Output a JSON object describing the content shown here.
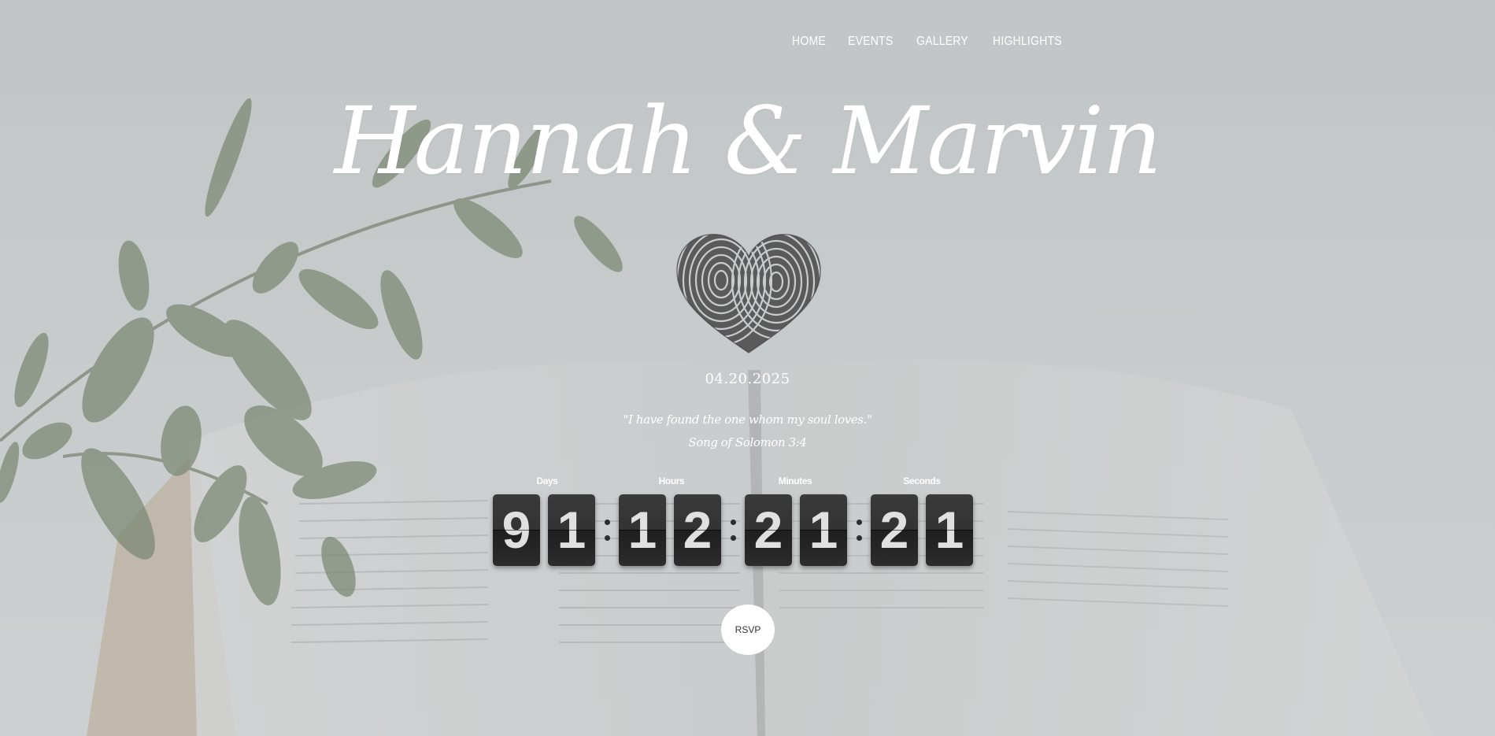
{
  "nav": {
    "items": [
      {
        "label": "HOME"
      },
      {
        "label": "EVENTS"
      },
      {
        "label": "GALLERY"
      },
      {
        "label": "HIGHLIGHTS"
      }
    ]
  },
  "hero": {
    "names": "Hannah & Marvin",
    "date": "04.20.2025",
    "quote": "\"I have found the one whom my soul loves.\"",
    "verse": "Song of Solomon 3:4"
  },
  "countdown": {
    "labels": {
      "days": "Days",
      "hours": "Hours",
      "minutes": "Minutes",
      "seconds": "Seconds"
    },
    "days": [
      "9",
      "1"
    ],
    "hours": [
      "1",
      "2"
    ],
    "minutes": [
      "2",
      "1"
    ],
    "seconds": [
      "2",
      "1"
    ]
  },
  "rsvp": {
    "label": "RSVP"
  },
  "icons": {
    "heart": "fingerprint-heart-icon"
  },
  "colors": {
    "text": "#ffffff",
    "flip_card": "#333333",
    "background": "#c5c8c9"
  }
}
